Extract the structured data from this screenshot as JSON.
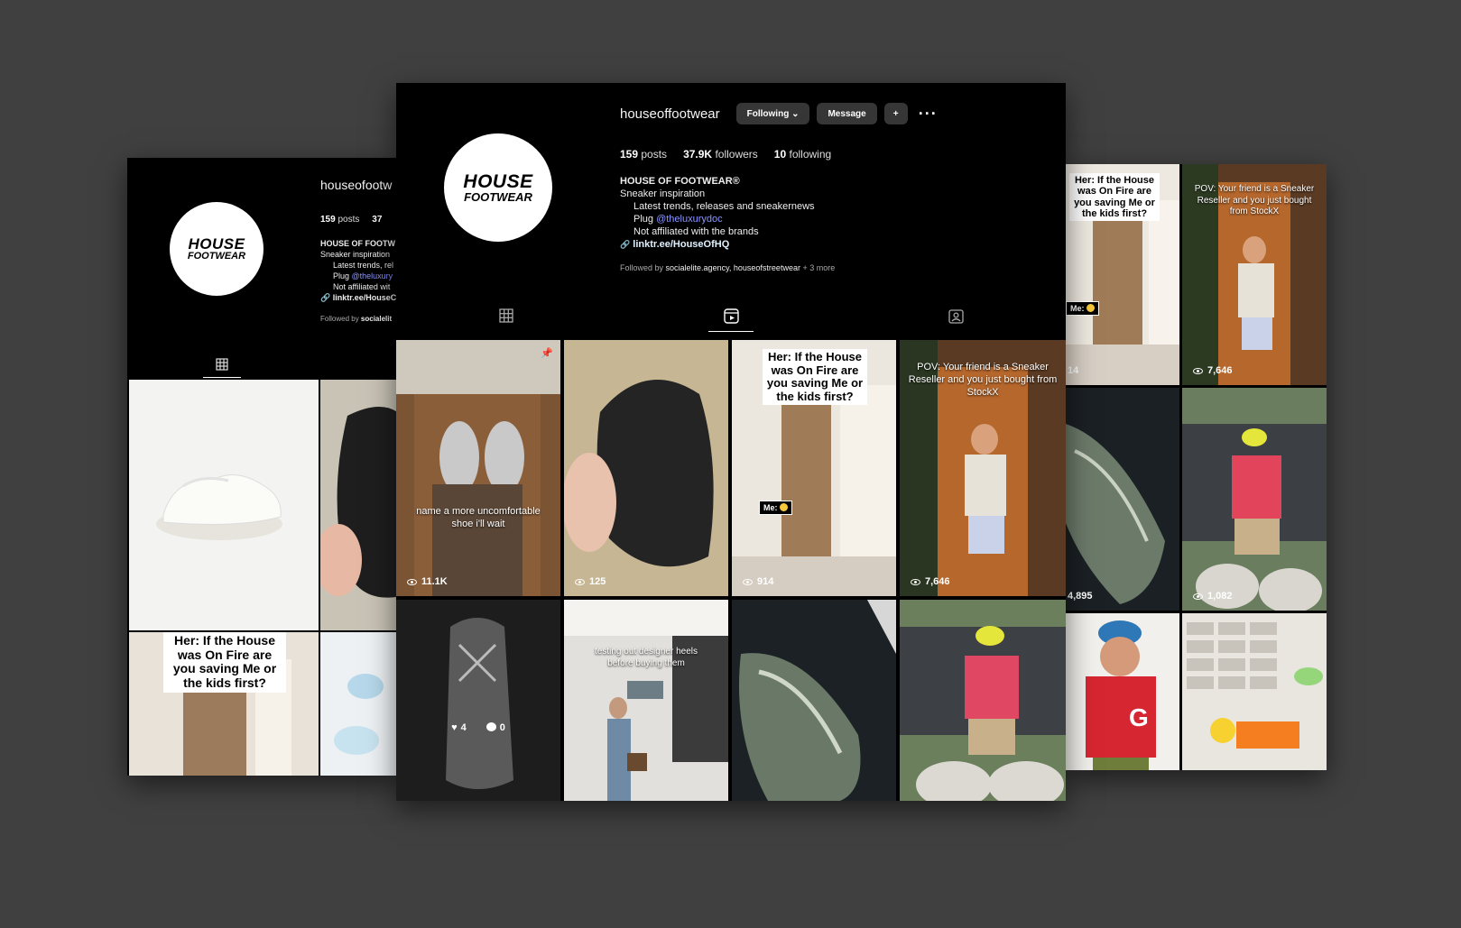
{
  "profile": {
    "username": "houseoffootwear",
    "logo_line1": "HOUSE",
    "logo_line2": "FOOTWEAR",
    "posts_count": "159",
    "posts_label": "posts",
    "followers_count": "37.9K",
    "followers_label": "followers",
    "following_count": "10",
    "following_label": "following",
    "display_name": "HOUSE OF FOOTWEAR®",
    "bio_line1": "Sneaker inspiration",
    "bio_line2": "Latest trends, releases and sneakernews",
    "bio_line3_prefix": "Plug ",
    "bio_line3_mention": "@theluxurydoc",
    "bio_line4": "Not affiliated with the brands",
    "bio_link": "linktr.ee/HouseOfHQ",
    "followed_prefix": "Followed by ",
    "followed_names": "socialelite.agency, houseofstreetwear",
    "followed_more": " + 3 more"
  },
  "left_panel": {
    "username": "houseofootw",
    "posts_count": "159",
    "posts_label": "posts",
    "followers_partial": "37",
    "display_name": "HOUSE OF FOOTW",
    "bio_line1": "Sneaker inspiration",
    "bio_line2": "Latest trends, rel",
    "bio_line3_prefix": "Plug ",
    "bio_line3_mention": "@theluxury",
    "bio_line4": "Not affiliated wit",
    "bio_link": "linktr.ee/HouseC",
    "followed_prefix": "Followed by ",
    "followed_names": "socialelit",
    "tile_caption": "Her: If the House was On Fire are you saving Me or the kids first?"
  },
  "buttons": {
    "following": "Following",
    "following_chevron": "⌄",
    "message": "Message",
    "add_person": "+",
    "more": "···"
  },
  "tabs": [
    "posts-grid",
    "reels",
    "tagged"
  ],
  "reels": [
    {
      "caption": "name a more uncomfortable shoe i'll wait",
      "views": "11.1K",
      "pinned": true
    },
    {
      "caption": "",
      "views": "125"
    },
    {
      "caption": "Her: If the House was On Fire are you saving Me or the kids first?",
      "me_tag": "Me:",
      "views": "914"
    },
    {
      "caption": "POV: Your friend is a Sneaker Reseller and you just bought from StockX",
      "views": "7,646"
    },
    {
      "caption": "",
      "likes": "4",
      "comments": "0"
    },
    {
      "caption": "testing out designer heels before buying them"
    },
    {
      "caption": ""
    },
    {
      "caption": ""
    }
  ],
  "right_panel": {
    "tiles": [
      {
        "caption": "Her: If the House was On Fire are you saving Me or the kids first?",
        "me_tag": "Me:",
        "views": "14"
      },
      {
        "caption": "POV: Your friend is a Sneaker Reseller and you just bought from StockX",
        "views": "7,646"
      },
      {
        "views": "4,895"
      },
      {
        "views": "1,082"
      },
      {
        "caption": ""
      },
      {
        "caption": ""
      }
    ]
  }
}
